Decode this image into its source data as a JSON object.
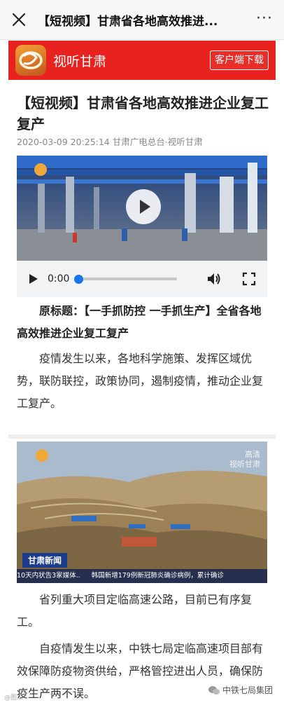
{
  "topbar": {
    "title": "【短视频】甘肃省各地高效推进...",
    "more": "···"
  },
  "brand": {
    "name": "视听甘肃",
    "download_button": "客户端下载",
    "accent": "#e8231f"
  },
  "article": {
    "title": "【短视频】甘肃省各地高效推进企业复工复产",
    "meta": "2020-03-09 20:25:14 甘肃广电总台·视听甘肃",
    "video": {
      "current_time": "0:00",
      "progress": 0.0
    },
    "original_title": "原标题：【一手抓防控 一手抓生产】全省各地高效推进企业复工复产",
    "paragraph1": "疫情发生以来，各地科学施策、发挥区域优势，联防联控，政策协同，遏制疫情，推动企业复工复产。"
  },
  "news_image": {
    "corner_tag_1": "高清",
    "corner_tag_2": "视听甘肃",
    "badge": "甘肃新闻",
    "ticker": [
      "10天内状告3家媒体..",
      "韩国新增179例新冠肺炎确诊病例，累计确诊"
    ]
  },
  "body": {
    "paragraph2": "省列重大项目定临高速公路，目前已有序复工。",
    "paragraph3": "自疫情发生以来，中铁七局定临高速项目部有效保障防疫物资供给，严格管控进出人员，确保防疫生产两不误。"
  },
  "footer": {
    "source": "中铁七局集团",
    "watermark": "@图工"
  }
}
